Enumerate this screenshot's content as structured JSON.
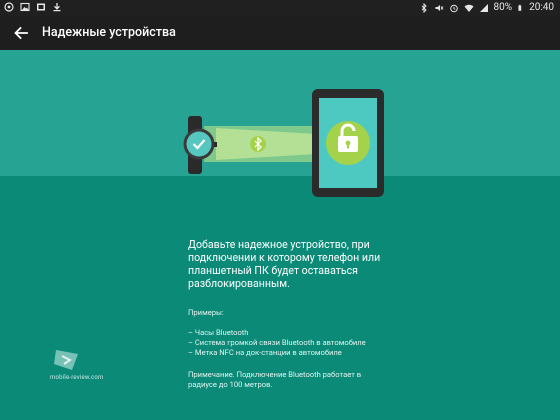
{
  "status_bar": {
    "battery": "80%",
    "time": "20:40",
    "left_icons": [
      "whatsapp-icon",
      "image-icon",
      "gallery-icon",
      "download-icon"
    ],
    "right_icons": [
      "bluetooth-icon",
      "mute-icon",
      "alarm-icon",
      "wifi-icon",
      "signal-icon"
    ]
  },
  "app_bar": {
    "title": "Надежные устройства",
    "back_icon": "arrow-back-icon"
  },
  "illustration": {
    "watch_icon": "smartwatch-icon",
    "bluetooth_icon": "bluetooth-icon",
    "tablet_icon": "tablet-unlocked-icon",
    "colors": {
      "hero_bg": "#27a393",
      "lower_bg": "#0b8a78",
      "accent_green": "#a4d24a",
      "screen": "#4ec9c2"
    }
  },
  "content": {
    "main_text": "Добавьте надежное устройство, при подключении к которому телефон или планшетный ПК будет оставаться разблокированным.",
    "examples_title": "Примеры:",
    "examples": [
      "– Часы Bluetooth",
      "– Система громкой связи Bluetooth в автомобиле",
      "– Метка NFC на док-станции в автомобиле"
    ],
    "note": "Примечание. Подключение Bluetooth работает в радиусе до 100 метров."
  },
  "watermark": {
    "text": "mobile-review.com"
  }
}
